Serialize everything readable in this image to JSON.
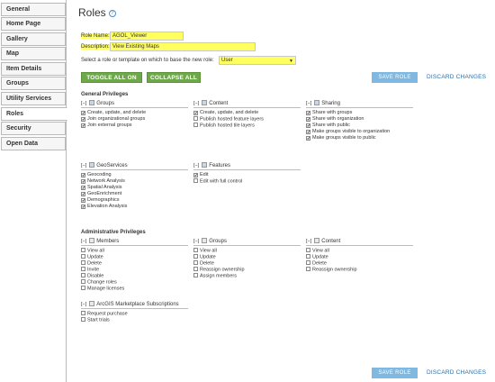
{
  "sidebar": {
    "items": [
      {
        "label": "General",
        "active": false
      },
      {
        "label": "Home Page",
        "active": false
      },
      {
        "label": "Gallery",
        "active": false
      },
      {
        "label": "Map",
        "active": false
      },
      {
        "label": "Item Details",
        "active": false
      },
      {
        "label": "Groups",
        "active": false
      },
      {
        "label": "Utility Services",
        "active": false
      },
      {
        "label": "Roles",
        "active": true
      },
      {
        "label": "Security",
        "active": false
      },
      {
        "label": "Open Data",
        "active": false
      }
    ]
  },
  "page": {
    "title": "Roles",
    "help_glyph": "?"
  },
  "form": {
    "role_name_label": "Role Name:",
    "role_name_value": "AGOL_Viewer",
    "description_label": "Description:",
    "description_value": "View Existing Maps",
    "template_label": "Select a role or template on which to base the new role:",
    "template_value": "User"
  },
  "buttons": {
    "toggle_all": "TOGGLE ALL ON",
    "collapse_all": "COLLAPSE ALL",
    "save_role": "SAVE ROLE",
    "discard": "DISCARD CHANGES"
  },
  "toggle_glyph": "[−]",
  "general": {
    "title": "General Privileges",
    "groups": {
      "label": "Groups",
      "items": [
        {
          "label": "Create, update, and delete",
          "checked": true
        },
        {
          "label": "Join organizational groups",
          "checked": true
        },
        {
          "label": "Join external groups",
          "checked": true
        }
      ]
    },
    "content": {
      "label": "Content",
      "items": [
        {
          "label": "Create, update, and delete",
          "checked": true
        },
        {
          "label": "Publish hosted feature layers",
          "checked": false
        },
        {
          "label": "Publish hosted tile layers",
          "checked": false
        }
      ]
    },
    "sharing": {
      "label": "Sharing",
      "items": [
        {
          "label": "Share with groups",
          "checked": true
        },
        {
          "label": "Share with organization",
          "checked": true
        },
        {
          "label": "Share with public",
          "checked": true
        },
        {
          "label": "Make groups visible to organization",
          "checked": true
        },
        {
          "label": "Make groups visible to public",
          "checked": true
        }
      ]
    },
    "geoservices": {
      "label": "GeoServices",
      "items": [
        {
          "label": "Geocoding",
          "checked": true
        },
        {
          "label": "Network Analysis",
          "checked": true
        },
        {
          "label": "Spatial Analysis",
          "checked": true
        },
        {
          "label": "GeoEnrichment",
          "checked": true
        },
        {
          "label": "Demographics",
          "checked": true
        },
        {
          "label": "Elevation Analysis",
          "checked": true
        }
      ]
    },
    "features": {
      "label": "Features",
      "items": [
        {
          "label": "Edit",
          "checked": true
        },
        {
          "label": "Edit with full control",
          "checked": false
        }
      ]
    }
  },
  "admin": {
    "title": "Administrative Privileges",
    "members": {
      "label": "Members",
      "items": [
        {
          "label": "View all",
          "checked": false
        },
        {
          "label": "Update",
          "checked": false
        },
        {
          "label": "Delete",
          "checked": false
        },
        {
          "label": "Invite",
          "checked": false
        },
        {
          "label": "Disable",
          "checked": false
        },
        {
          "label": "Change roles",
          "checked": false
        },
        {
          "label": "Manage licenses",
          "checked": false
        }
      ]
    },
    "groups": {
      "label": "Groups",
      "items": [
        {
          "label": "View all",
          "checked": false
        },
        {
          "label": "Update",
          "checked": false
        },
        {
          "label": "Delete",
          "checked": false
        },
        {
          "label": "Reassign ownership",
          "checked": false
        },
        {
          "label": "Assign members",
          "checked": false
        }
      ]
    },
    "content": {
      "label": "Content",
      "items": [
        {
          "label": "View all",
          "checked": false
        },
        {
          "label": "Update",
          "checked": false
        },
        {
          "label": "Delete",
          "checked": false
        },
        {
          "label": "Reassign ownership",
          "checked": false
        }
      ]
    },
    "marketplace": {
      "label": "ArcGIS Marketplace Subscriptions",
      "items": [
        {
          "label": "Request purchase",
          "checked": false
        },
        {
          "label": "Start trials",
          "checked": false
        }
      ]
    }
  }
}
